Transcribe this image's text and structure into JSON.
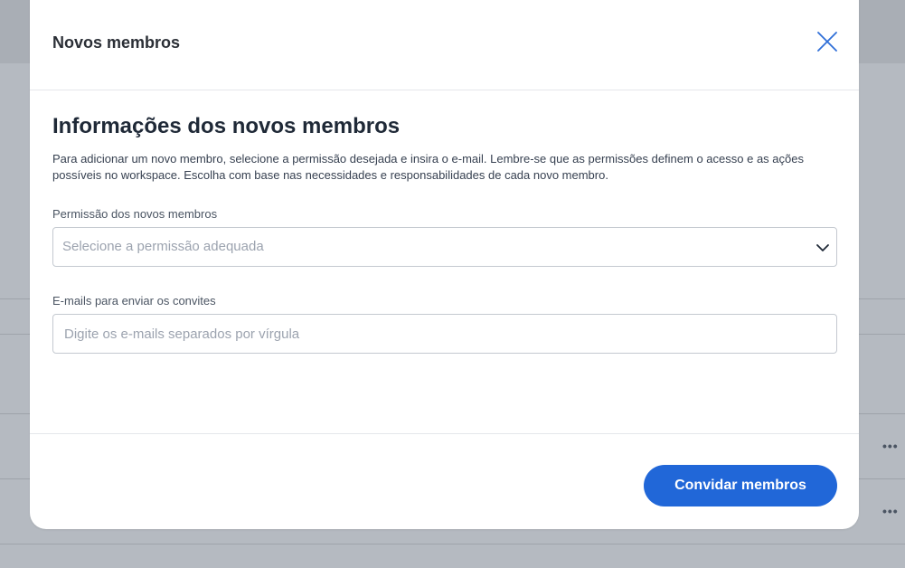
{
  "modal": {
    "title": "Novos membros",
    "close_icon": "close-icon"
  },
  "form": {
    "section_title": "Informações dos novos membros",
    "description": "Para adicionar um novo membro, selecione a permissão desejada e insira o e-mail. Lembre-se que as permissões definem o acesso e as ações possíveis no workspace. Escolha com base nas necessidades e responsabilidades de cada novo membro.",
    "permission": {
      "label": "Permissão dos novos membros",
      "placeholder": "Selecione a permissão adequada",
      "icon": "chevron-down-icon"
    },
    "emails": {
      "label": "E-mails para enviar os convites",
      "placeholder": "Digite os e-mails separados por vírgula",
      "value": ""
    }
  },
  "footer": {
    "submit_label": "Convidar membros"
  },
  "background": {
    "row_actions": [
      "•••",
      "•••"
    ]
  },
  "colors": {
    "primary": "#2167d8",
    "close_icon": "#2f6fd8",
    "overlay": "#b5bac1"
  }
}
